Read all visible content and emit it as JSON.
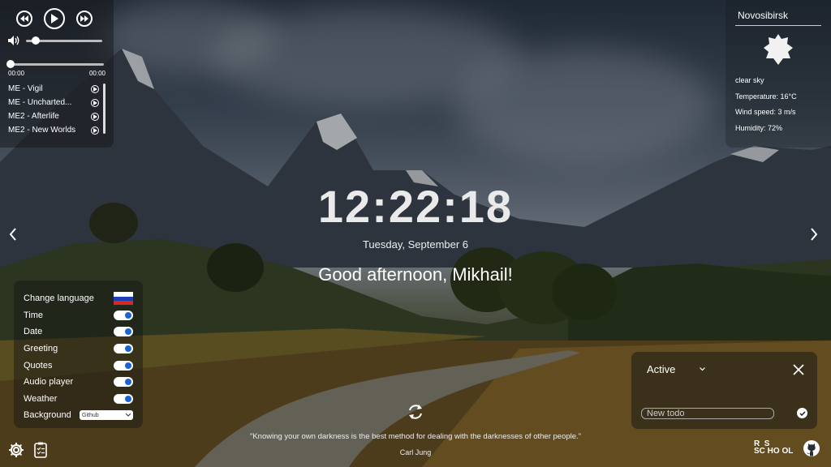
{
  "player": {
    "time_start": "00:00",
    "time_end": "00:00",
    "volume": 0.1,
    "progress": 0,
    "playlist": [
      {
        "title": "ME - Vigil"
      },
      {
        "title": "ME - Uncharted..."
      },
      {
        "title": "ME2 - Afterlife"
      },
      {
        "title": "ME2 - New Worlds"
      }
    ]
  },
  "weather": {
    "city": "Novosibirsk",
    "description": "clear sky",
    "temperature": "Temperature: 16°C",
    "wind": "Wind speed: 3 m/s",
    "humidity": "Humidity: 72%"
  },
  "clock": {
    "time": "12:22:18",
    "date": "Tuesday, September 6"
  },
  "greeting": {
    "text": "Good afternoon,",
    "name": "Mikhail!"
  },
  "quote": {
    "text": "\"Knowing your own darkness is the best method for dealing with the darknesses of other people.\"",
    "author": "Carl Jung"
  },
  "settings": {
    "change_language": "Change language",
    "language_flag": "russia-flag",
    "items": [
      {
        "label": "Time",
        "on": true
      },
      {
        "label": "Date",
        "on": true
      },
      {
        "label": "Greeting",
        "on": true
      },
      {
        "label": "Quotes",
        "on": true
      },
      {
        "label": "Audio player",
        "on": true
      },
      {
        "label": "Weather",
        "on": true
      }
    ],
    "background_label": "Background",
    "background_value": "Github"
  },
  "todo": {
    "filter": "Active",
    "placeholder": "New todo"
  },
  "footer": {
    "logo_text": "RS SCHOOL"
  },
  "colors": {
    "toggle_accent": "#1a63d6",
    "panel_bg": "rgba(20,20,20,0.45)"
  }
}
